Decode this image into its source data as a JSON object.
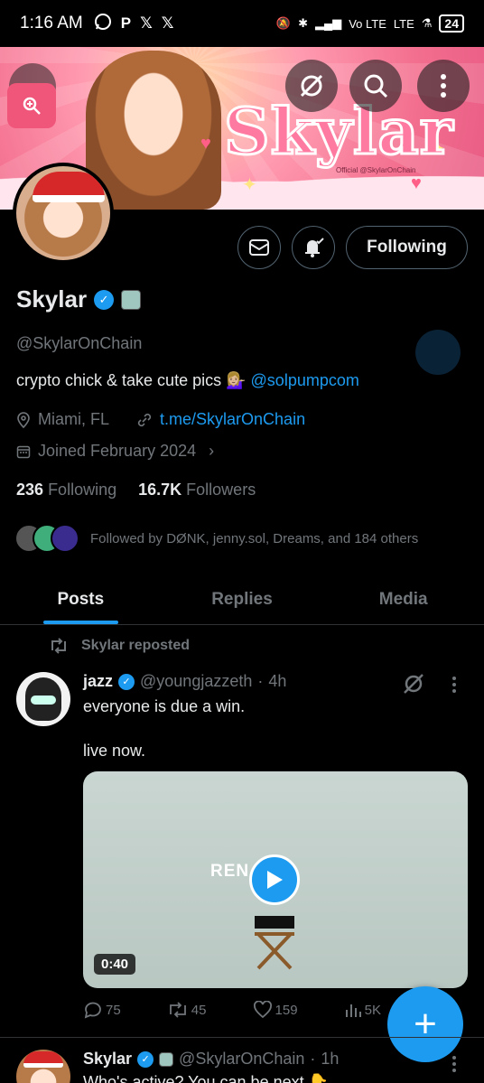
{
  "status_bar": {
    "time": "1:16 AM",
    "app_icons": [
      "whatsapp-icon",
      "p-icon",
      "x-icon",
      "x-icon"
    ],
    "right_text": "Vo LTE",
    "network": "LTE",
    "battery": "24"
  },
  "banner": {
    "title": "Skylar",
    "subtitle": "Official @SkylarOnChain"
  },
  "profile": {
    "follow_label": "Following",
    "name": "Skylar",
    "handle": "@SkylarOnChain",
    "bio_text": "crypto chick & take cute pics 💁🏼‍♀️",
    "bio_mention": "@solpumpcom",
    "location": "Miami, FL",
    "link": "t.me/SkylarOnChain",
    "joined": "Joined February 2024",
    "following_count": "236",
    "following_label": "Following",
    "followers_count": "16.7K",
    "followers_label": "Followers",
    "followed_by": "Followed by DØNK, jenny.sol, Dreams, and 184 others"
  },
  "tabs": [
    {
      "label": "Posts",
      "active": true
    },
    {
      "label": "Replies",
      "active": false
    },
    {
      "label": "Media",
      "active": false
    }
  ],
  "post1": {
    "repost_label": "Skylar reposted",
    "name": "jazz",
    "handle": "@youngjazzeth",
    "time": "4h",
    "text1": "everyone is due a win.",
    "text2": "live now.",
    "media_word": "REN    DUE",
    "duration": "0:40",
    "replies": "75",
    "reposts": "45",
    "likes": "159",
    "views": "5K"
  },
  "post2": {
    "name": "Skylar",
    "handle": "@SkylarOnChain",
    "time": "1h",
    "text": "Who's active? You can be next 👇"
  },
  "colors": {
    "accent": "#1d9bf0",
    "background": "#000000",
    "muted": "#71767b"
  }
}
